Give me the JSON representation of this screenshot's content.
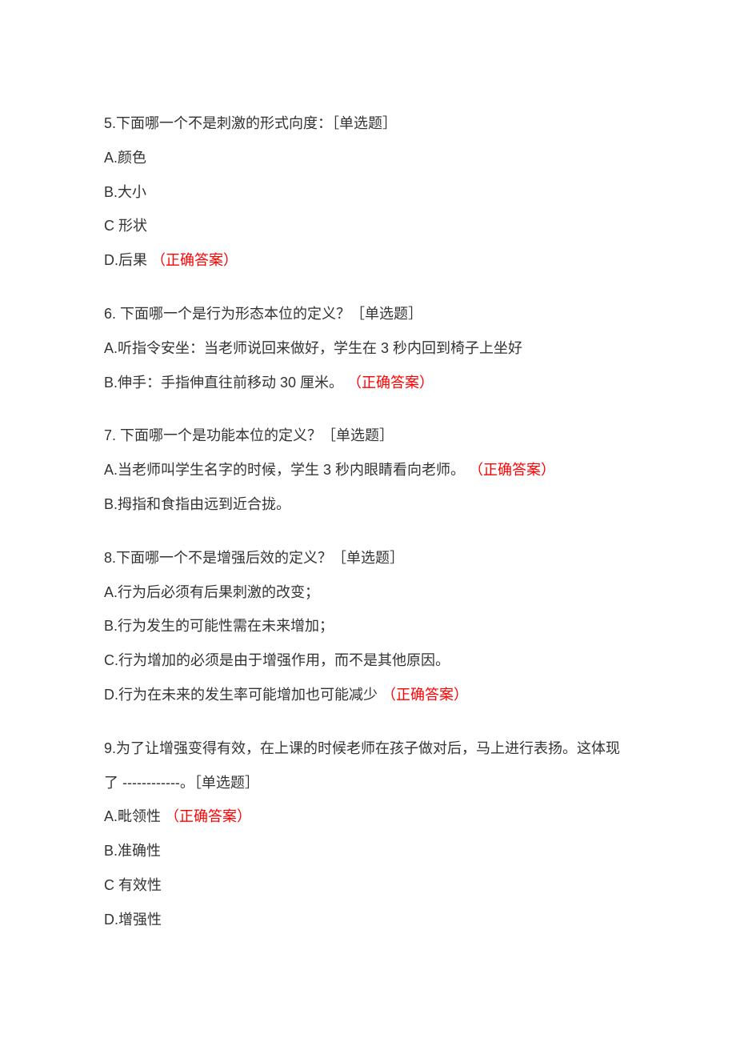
{
  "questions": [
    {
      "prompt": "5.下面哪一个不是刺激的形式向度：［单选题］",
      "options": [
        {
          "label": "A.颜色",
          "answer": ""
        },
        {
          "label": "B.大小",
          "answer": ""
        },
        {
          "label": "C 形状",
          "answer": ""
        },
        {
          "label": "D.后果",
          "answer": "（正确答案）"
        }
      ]
    },
    {
      "prompt": "6. 下面哪一个是行为形态本位的定义？［单选题］",
      "options": [
        {
          "label": "A.听指令安坐：当老师说回来做好，学生在 3 秒内回到椅子上坐好",
          "answer": ""
        },
        {
          "label": "B.伸手：手指伸直往前移动 30 厘米。",
          "answer": "（正确答案）"
        }
      ]
    },
    {
      "prompt": "7. 下面哪一个是功能本位的定义？［单选题］",
      "options": [
        {
          "label": "A.当老师叫学生名字的时候，学生 3 秒内眼睛看向老师。",
          "answer": "（正确答案）"
        },
        {
          "label": "B.拇指和食指由远到近合拢。",
          "answer": ""
        }
      ]
    },
    {
      "prompt": "8.下面哪一个不是增强后效的定义？［单选题］",
      "options": [
        {
          "label": "A.行为后必须有后果刺激的改变；",
          "answer": ""
        },
        {
          "label": "B.行为发生的可能性需在未来增加；",
          "answer": ""
        },
        {
          "label": "C.行为增加的必须是由于增强作用，而不是其他原因。",
          "answer": ""
        },
        {
          "label": "D.行为在未来的发生率可能增加也可能减少",
          "answer": "（正确答案）"
        }
      ]
    },
    {
      "prompt_part1": "9.为了让增强变得有效，在上课的时候老师在孩子做对后，马上进行表扬。这体现",
      "prompt_part2": "了 ------------。［单选题］",
      "options": [
        {
          "label": "A.毗领性",
          "answer": "（正确答案）"
        },
        {
          "label": "B.准确性",
          "answer": ""
        },
        {
          "label": "C 有效性",
          "answer": ""
        },
        {
          "label": "D.增强性",
          "answer": ""
        }
      ]
    }
  ]
}
